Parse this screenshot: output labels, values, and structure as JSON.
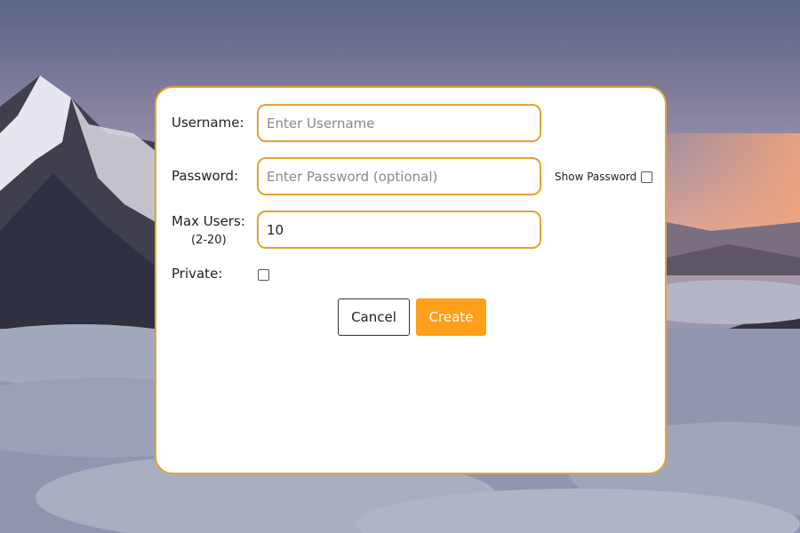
{
  "form": {
    "username_label": "Username:",
    "username_placeholder": "Enter Username",
    "username_value": "",
    "password_label": "Password:",
    "password_placeholder": "Enter Password (optional)",
    "password_value": "",
    "show_password_label": "Show Password",
    "show_password_checked": false,
    "max_users_label": "Max Users:",
    "max_users_range": "(2-20)",
    "max_users_value": "10",
    "private_label": "Private:",
    "private_checked": false,
    "cancel_label": "Cancel",
    "create_label": "Create"
  },
  "colors": {
    "accent": "#e6a32e",
    "create_button": "#ff9f1a"
  }
}
